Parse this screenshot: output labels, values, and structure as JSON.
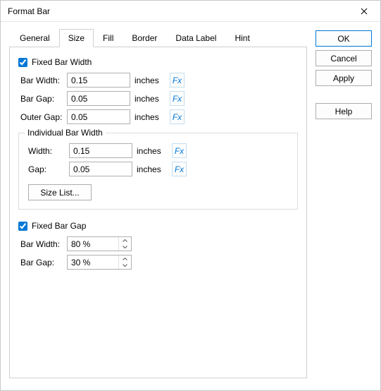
{
  "window": {
    "title": "Format Bar"
  },
  "tabs": {
    "general": "General",
    "size": "Size",
    "fill": "Fill",
    "border": "Border",
    "dataLabel": "Data Label",
    "hint": "Hint"
  },
  "fixedBarWidth": {
    "checkboxLabel": "Fixed Bar Width",
    "barWidth": {
      "label": "Bar Width:",
      "value": "0.15",
      "unit": "inches"
    },
    "barGap": {
      "label": "Bar Gap:",
      "value": "0.05",
      "unit": "inches"
    },
    "outerGap": {
      "label": "Outer Gap:",
      "value": "0.05",
      "unit": "inches"
    }
  },
  "individual": {
    "title": "Individual Bar Width",
    "width": {
      "label": "Width:",
      "value": "0.15",
      "unit": "inches"
    },
    "gap": {
      "label": "Gap:",
      "value": "0.05",
      "unit": "inches"
    },
    "sizeListBtn": "Size List..."
  },
  "fixedBarGap": {
    "checkboxLabel": "Fixed Bar Gap",
    "barWidth": {
      "label": "Bar Width:",
      "value": "80 %"
    },
    "barGap": {
      "label": "Bar Gap:",
      "value": "30 %"
    }
  },
  "buttons": {
    "ok": "OK",
    "cancel": "Cancel",
    "apply": "Apply",
    "help": "Help"
  },
  "fxLabel": "Fx"
}
